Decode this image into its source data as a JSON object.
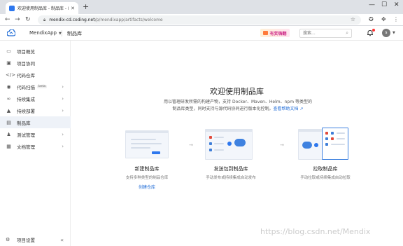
{
  "browser": {
    "tab_title": "欢迎使用制品库 - 制品库 - Mend",
    "url_host": "mendix-cd.coding.net",
    "url_path": "/p/mendixapp/artifacts/welcome"
  },
  "header": {
    "project_name": "MendixApp",
    "breadcrumb": "制品库",
    "promo_label": "有奖嗨翻",
    "search_placeholder": "搜索...",
    "avatar_letter": "s"
  },
  "sidebar": {
    "items": [
      {
        "label": "项目概览",
        "icon": "overview-icon"
      },
      {
        "label": "项目协同",
        "icon": "collab-icon"
      },
      {
        "label": "代码仓库",
        "icon": "code-icon"
      },
      {
        "label": "代码扫描",
        "icon": "scan-icon",
        "badge": "beta"
      },
      {
        "label": "持续集成",
        "icon": "ci-icon"
      },
      {
        "label": "持续部署",
        "icon": "cd-icon"
      },
      {
        "label": "制品库",
        "icon": "artifact-icon"
      },
      {
        "label": "测试管理",
        "icon": "test-icon"
      },
      {
        "label": "文档管理",
        "icon": "doc-icon"
      }
    ],
    "footer_label": "项目设置"
  },
  "main": {
    "title": "欢迎使用制品库",
    "desc_line1": "用以管理研发所需的构建产物，支持 Docker、Maven、Helm、npm 等类型的",
    "desc_line2": "制品库类型，同时支持与源代码协同进行版本化控制。",
    "help_link": "查看帮助文档",
    "steps": [
      {
        "name": "新建制品库",
        "sub": "支持多种类型的制品仓库",
        "action": "创建仓库"
      },
      {
        "name": "发送包到制品库",
        "sub": "手动发布或持续集成自动发布"
      },
      {
        "name": "拉取制品库",
        "sub": "手动拉取或持续集成自动拉取"
      }
    ]
  },
  "watermark": "https://blog.csdn.net/Mendix",
  "colors": {
    "accent": "#1e6bd6",
    "active_bg": "#eef2f8"
  }
}
